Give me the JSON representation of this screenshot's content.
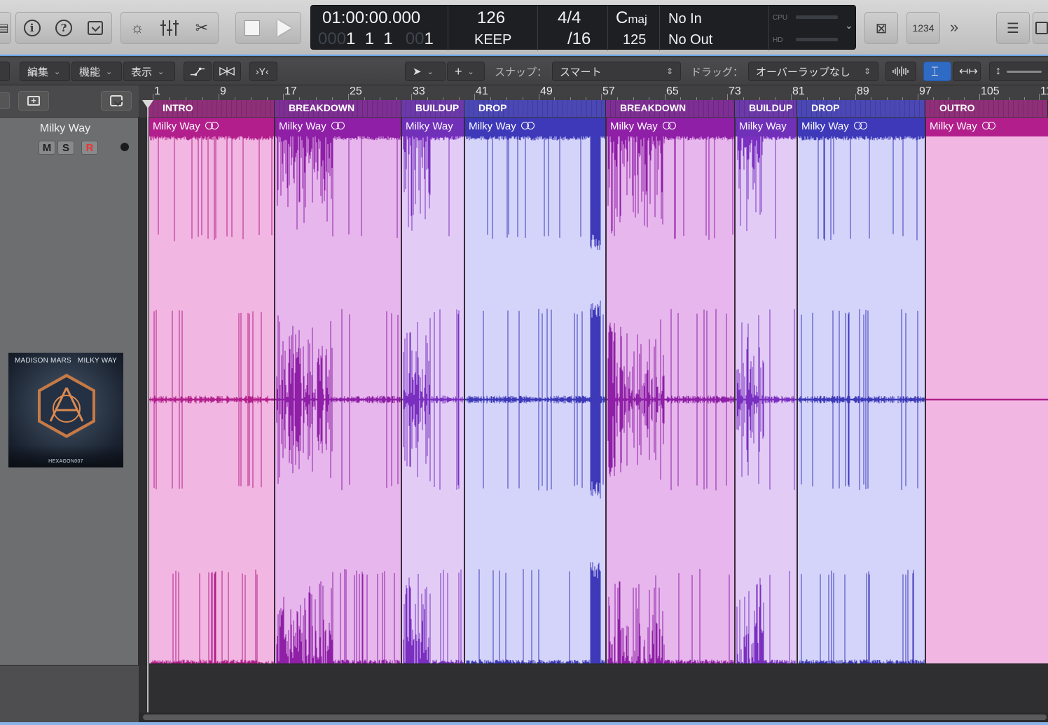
{
  "control_bar": {
    "buttons": [
      {
        "name": "library-icon"
      },
      {
        "name": "info-icon",
        "glyph": "i"
      },
      {
        "name": "help-icon",
        "glyph": "?"
      },
      {
        "name": "toolbar-toggle-icon"
      },
      {
        "name": "smart-controls-icon",
        "glyph": "☼"
      },
      {
        "name": "mixer-icon",
        "glyph": "⫶"
      },
      {
        "name": "editors-icon",
        "glyph": "✂"
      }
    ],
    "lcd": {
      "time": "01:00:00.000",
      "bar_dim": "000",
      "bar_digits": "1  1  1",
      "bar_dim2": "00",
      "bar_end": "1",
      "tempo": "126",
      "tempo_mode": "KEEP",
      "signature": "4/4",
      "division": "/16",
      "key_main": "C",
      "key_sub": "maj",
      "key_number": "125",
      "input": "No In",
      "output": "No Out",
      "cpu_label": "CPU",
      "hd_label": "HD"
    },
    "right_buttons": {
      "count_in_label": "1234"
    }
  },
  "toolbar": {
    "edit_menu": "編集",
    "functions_menu": "機能",
    "view_menu": "表示",
    "snap_label": "スナップ：",
    "snap_value": "スマート",
    "drag_label": "ドラッグ：",
    "drag_value": "オーバーラップなし"
  },
  "track": {
    "name": "Milky Way",
    "mute": "M",
    "solo": "S",
    "record": "R",
    "artwork": {
      "artist": "MADISON MARS",
      "title": "MILKY WAY",
      "label": "HEXAGON007"
    }
  },
  "ruler": {
    "ticks": [
      "1",
      "9",
      "17",
      "25",
      "33",
      "41",
      "49",
      "57",
      "65",
      "73",
      "81",
      "89",
      "97",
      "105",
      "11"
    ]
  },
  "markers": [
    {
      "label": "INTRO",
      "color": "pink"
    },
    {
      "label": "BREAKDOWN",
      "color": "purple"
    },
    {
      "label": "BUILDUP",
      "color": "violet"
    },
    {
      "label": "DROP",
      "color": "blue"
    },
    {
      "label": "BREAKDOWN",
      "color": "purple"
    },
    {
      "label": "BUILDUP",
      "color": "violet"
    },
    {
      "label": "DROP",
      "color": "blue"
    },
    {
      "label": "OUTRO",
      "color": "pink"
    }
  ],
  "regions": [
    {
      "name": "Milky Way",
      "loop": true,
      "section": "intro"
    },
    {
      "name": "Milky Way",
      "loop": true,
      "section": "breakdown"
    },
    {
      "name": "Milky Way",
      "loop": false,
      "section": "buildup"
    },
    {
      "name": "Milky Way",
      "loop": true,
      "section": "drop"
    },
    {
      "name": "Milky Way",
      "loop": true,
      "section": "breakdown"
    },
    {
      "name": "Milky Way",
      "loop": false,
      "section": "buildup"
    },
    {
      "name": "Milky Way",
      "loop": true,
      "section": "drop"
    },
    {
      "name": "Milky Way",
      "loop": true,
      "section": "outro"
    }
  ],
  "colors": {
    "intro_body": "#f1b6e1",
    "intro_head": "#b21f8c",
    "breakdown_body": "#e6b6ec",
    "breakdown_head": "#8e1fa6",
    "buildup_body": "#e2ccf6",
    "buildup_head": "#7030b8",
    "drop_body": "#d4d4fa",
    "drop_head": "#3d39b8",
    "accent_blue": "#2f6bc4"
  }
}
